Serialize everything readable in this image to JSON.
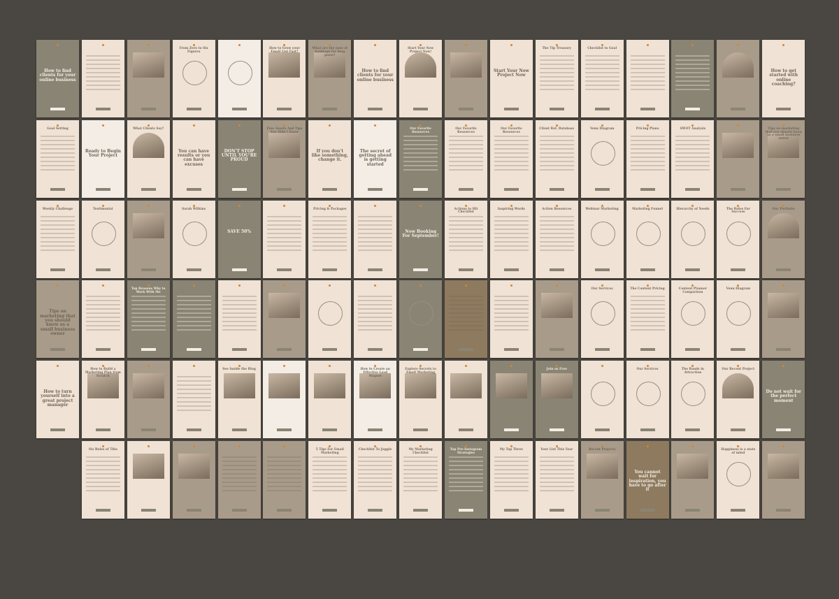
{
  "collection": {
    "rows": 6,
    "columns": 17,
    "background_color": "#4a4641",
    "palette": {
      "olive": "#8a8474",
      "cream": "#f3ede6",
      "peach": "#f0e2d4",
      "brown": "#8e7a5e",
      "accent": "#c98a3a"
    },
    "tiles": [
      {
        "variant": "olive",
        "layout": "title",
        "title": "How to find clients for your online business"
      },
      {
        "variant": "cream",
        "layout": "lines",
        "title": ""
      },
      {
        "variant": "photo",
        "layout": "photo",
        "title": ""
      },
      {
        "variant": "cream",
        "layout": "circle",
        "title": "From Zero to Six Figures"
      },
      {
        "variant": "peach",
        "layout": "circle",
        "title": ""
      },
      {
        "variant": "cream",
        "layout": "photo",
        "title": "How to Grow your Email List Fast?"
      },
      {
        "variant": "photo",
        "layout": "photo",
        "title": "What are the uses of hashtags for blog posts?"
      },
      {
        "variant": "cream",
        "layout": "title",
        "title": "How to find clients for your online business"
      },
      {
        "variant": "cream",
        "layout": "arch",
        "title": "Start Your New Project Now!"
      },
      {
        "variant": "photo",
        "layout": "photo",
        "title": ""
      },
      {
        "variant": "cream",
        "layout": "title",
        "title": "Start Your New Project Now"
      },
      {
        "variant": "cream",
        "layout": "lines",
        "title": "The Tip Treasury"
      },
      {
        "variant": "cream",
        "layout": "lines",
        "title": "Checklist to Goal"
      },
      {
        "variant": "cream",
        "layout": "lines",
        "title": ""
      },
      {
        "variant": "olive",
        "layout": "lines",
        "title": ""
      },
      {
        "variant": "photo",
        "layout": "arch",
        "title": ""
      },
      {
        "variant": "cream",
        "layout": "title",
        "title": "How to get started with online coaching?"
      },
      {
        "variant": "cream",
        "layout": "lines",
        "title": "Goal Setting"
      },
      {
        "variant": "peach",
        "layout": "title",
        "title": "Ready to Begin Your Project"
      },
      {
        "variant": "cream",
        "layout": "arch",
        "title": "What Clients Say?"
      },
      {
        "variant": "cream",
        "layout": "title",
        "title": "You can have results or you can have excuses"
      },
      {
        "variant": "olive",
        "layout": "big",
        "title": "DON'T STOP UNTIL YOU'RE PROUD"
      },
      {
        "variant": "photo",
        "layout": "photo",
        "title": "Free Assets And Tips You Didn't Know"
      },
      {
        "variant": "cream",
        "layout": "title",
        "title": "If you don't like something, change it."
      },
      {
        "variant": "peach",
        "layout": "title",
        "title": "The secret of getting ahead is getting started"
      },
      {
        "variant": "olive",
        "layout": "lines",
        "title": "Our Favorite Resources"
      },
      {
        "variant": "cream",
        "layout": "lines",
        "title": "Our Favorite Resources"
      },
      {
        "variant": "cream",
        "layout": "lines",
        "title": "Our Favorite Resources"
      },
      {
        "variant": "cream",
        "layout": "lines",
        "title": "Client Ref. Database"
      },
      {
        "variant": "cream",
        "layout": "circle",
        "title": "Venn Diagram"
      },
      {
        "variant": "cream",
        "layout": "lines",
        "title": "Pricing Plans"
      },
      {
        "variant": "cream",
        "layout": "lines",
        "title": "SWOT Analysis"
      },
      {
        "variant": "photo",
        "layout": "photo",
        "title": ""
      },
      {
        "variant": "photo",
        "layout": "photo",
        "title": "Tips on marketing that you should know as a small business owner"
      },
      {
        "variant": "cream",
        "layout": "lines",
        "title": "Weekly Challenge"
      },
      {
        "variant": "cream",
        "layout": "circle",
        "title": "Testimonial"
      },
      {
        "variant": "photo",
        "layout": "photo",
        "title": ""
      },
      {
        "variant": "cream",
        "layout": "circle",
        "title": "Sarah Wilkins"
      },
      {
        "variant": "olive",
        "layout": "big",
        "title": "SAVE 50%"
      },
      {
        "variant": "cream",
        "layout": "lines",
        "title": ""
      },
      {
        "variant": "cream",
        "layout": "lines",
        "title": "Pricing & Packages"
      },
      {
        "variant": "cream",
        "layout": "lines",
        "title": ""
      },
      {
        "variant": "olive",
        "layout": "title",
        "title": "Now Booking For September!"
      },
      {
        "variant": "cream",
        "layout": "lines",
        "title": "Actions to Hit Checklist"
      },
      {
        "variant": "cream",
        "layout": "lines",
        "title": "Inspiring Words"
      },
      {
        "variant": "cream",
        "layout": "lines",
        "title": "Action Resources"
      },
      {
        "variant": "cream",
        "layout": "circle",
        "title": "Webinar Marketing"
      },
      {
        "variant": "cream",
        "layout": "circle",
        "title": "Marketing Funnel"
      },
      {
        "variant": "cream",
        "layout": "circle",
        "title": "Hierarchy of Needs"
      },
      {
        "variant": "cream",
        "layout": "circle",
        "title": "The Rules For Success"
      },
      {
        "variant": "photo",
        "layout": "arch",
        "title": "Our Portfolio"
      },
      {
        "variant": "photo",
        "layout": "title",
        "title": "Tips on marketing that you should know as a small business owner"
      },
      {
        "variant": "cream",
        "layout": "lines",
        "title": ""
      },
      {
        "variant": "olive",
        "layout": "lines",
        "title": "Top Reasons Why to Work With Me"
      },
      {
        "variant": "olive",
        "layout": "lines",
        "title": ""
      },
      {
        "variant": "cream",
        "layout": "lines",
        "title": ""
      },
      {
        "variant": "photo",
        "layout": "photo",
        "title": ""
      },
      {
        "variant": "cream",
        "layout": "circle",
        "title": ""
      },
      {
        "variant": "cream",
        "layout": "lines",
        "title": ""
      },
      {
        "variant": "olive",
        "layout": "circle",
        "title": ""
      },
      {
        "variant": "brown",
        "layout": "lines",
        "title": ""
      },
      {
        "variant": "cream",
        "layout": "lines",
        "title": ""
      },
      {
        "variant": "photo",
        "layout": "photo",
        "title": ""
      },
      {
        "variant": "cream",
        "layout": "circle",
        "title": "Our Services"
      },
      {
        "variant": "cream",
        "layout": "lines",
        "title": "The Content Pricing"
      },
      {
        "variant": "cream",
        "layout": "circle",
        "title": "Content Planner Comparison"
      },
      {
        "variant": "cream",
        "layout": "circle",
        "title": "Venn Diagram"
      },
      {
        "variant": "photo",
        "layout": "photo",
        "title": ""
      },
      {
        "variant": "cream",
        "layout": "title",
        "title": "How to turn yourself into a great project manager"
      },
      {
        "variant": "cream",
        "layout": "photo",
        "title": "How to Build a Marketing Plan from Scratch"
      },
      {
        "variant": "photo",
        "layout": "photo",
        "title": ""
      },
      {
        "variant": "cream",
        "layout": "lines",
        "title": ""
      },
      {
        "variant": "cream",
        "layout": "photo",
        "title": "See Inside the Blog"
      },
      {
        "variant": "peach",
        "layout": "photo",
        "title": ""
      },
      {
        "variant": "cream",
        "layout": "photo",
        "title": ""
      },
      {
        "variant": "peach",
        "layout": "photo",
        "title": "How to Create an Effective Lead Magnet"
      },
      {
        "variant": "cream",
        "layout": "photo",
        "title": "Explore Secrets to Email Marketing"
      },
      {
        "variant": "cream",
        "layout": "photo",
        "title": ""
      },
      {
        "variant": "olive",
        "layout": "photo",
        "title": ""
      },
      {
        "variant": "olive",
        "layout": "photo",
        "title": "Join us Free"
      },
      {
        "variant": "cream",
        "layout": "circle",
        "title": ""
      },
      {
        "variant": "cream",
        "layout": "circle",
        "title": "Our Services"
      },
      {
        "variant": "cream",
        "layout": "circle",
        "title": "The Bands in Attraction"
      },
      {
        "variant": "cream",
        "layout": "arch",
        "title": "Our Recent Project"
      },
      {
        "variant": "olive",
        "layout": "title",
        "title": "Do not wait for the perfect moment"
      },
      {
        "variant": "empty",
        "layout": "empty",
        "title": ""
      },
      {
        "variant": "cream",
        "layout": "lines",
        "title": "Six Rules of This"
      },
      {
        "variant": "cream",
        "layout": "photo",
        "title": ""
      },
      {
        "variant": "photo",
        "layout": "photo",
        "title": ""
      },
      {
        "variant": "photo",
        "layout": "lines",
        "title": ""
      },
      {
        "variant": "photo",
        "layout": "lines",
        "title": ""
      },
      {
        "variant": "cream",
        "layout": "lines",
        "title": "5 Tips For Email Marketing"
      },
      {
        "variant": "cream",
        "layout": "lines",
        "title": "Checklist To Juggle"
      },
      {
        "variant": "cream",
        "layout": "lines",
        "title": "My Marketing Checklist"
      },
      {
        "variant": "olive",
        "layout": "lines",
        "title": "Top Pre-Instagram Strategies"
      },
      {
        "variant": "cream",
        "layout": "lines",
        "title": "My Top Three"
      },
      {
        "variant": "cream",
        "layout": "lines",
        "title": "Your List This Year"
      },
      {
        "variant": "photo",
        "layout": "photo",
        "title": "Recent Projects"
      },
      {
        "variant": "brown",
        "layout": "title",
        "title": "You cannot wait for inspiration, you have to go after it"
      },
      {
        "variant": "photo",
        "layout": "photo",
        "title": ""
      },
      {
        "variant": "cream",
        "layout": "circle",
        "title": "Happiness is a state of mind"
      },
      {
        "variant": "photo",
        "layout": "photo",
        "title": ""
      },
      {
        "variant": "empty",
        "layout": "empty",
        "title": ""
      }
    ]
  }
}
